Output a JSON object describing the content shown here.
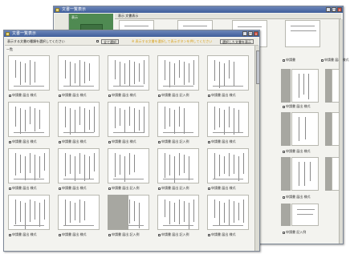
{
  "back_window": {
    "title": "文書一覧表示",
    "panel_label": "表示",
    "header_tab": "表示  文書表示",
    "captions": [
      "申請書",
      "申請書 届出 様式",
      "申請書 届出 様式",
      "申請書 届出 様式",
      "申請書 記入例",
      "申請書 届出 様式"
    ]
  },
  "front_window": {
    "title": "文書一覧表示",
    "toolbar_text": "表示する文書の種類を選択してください",
    "select_all_label": "全て選択",
    "notice_text": "※ 表示する文書を選択して表示ボタンを押してください",
    "show_button": "選択した文書を表示",
    "section_label": "一覧",
    "rows": [
      [
        "申請書 届出 様式",
        "申請書 届出 様式",
        "申請書 届出 様式",
        "申請書 届出 記入例",
        "申請書 届出 様式"
      ],
      [
        "申請書 届出 様式",
        "申請書 届出 様式",
        "申請書 届出 様式",
        "申請書 届出 記入例",
        "申請書 届出 様式"
      ],
      [
        "申請書 届出 様式",
        "申請書 届出 様式",
        "申請書 届出 記入例",
        "申請書 届出 記入例",
        "申請書 届出 様式"
      ],
      [
        "申請書 届出 様式",
        "申請書 届出 様式",
        "申請書 届出 記入例",
        "申請書 届出 記入例",
        "申請書 届出 様式"
      ]
    ]
  },
  "colors": {
    "title_bar": "#3f5f9b",
    "window_bg": "#f3f3ef",
    "green_panel": "#4f8a52",
    "notice_text": "#d9a21b",
    "gray_column": "#a7a7a1"
  }
}
